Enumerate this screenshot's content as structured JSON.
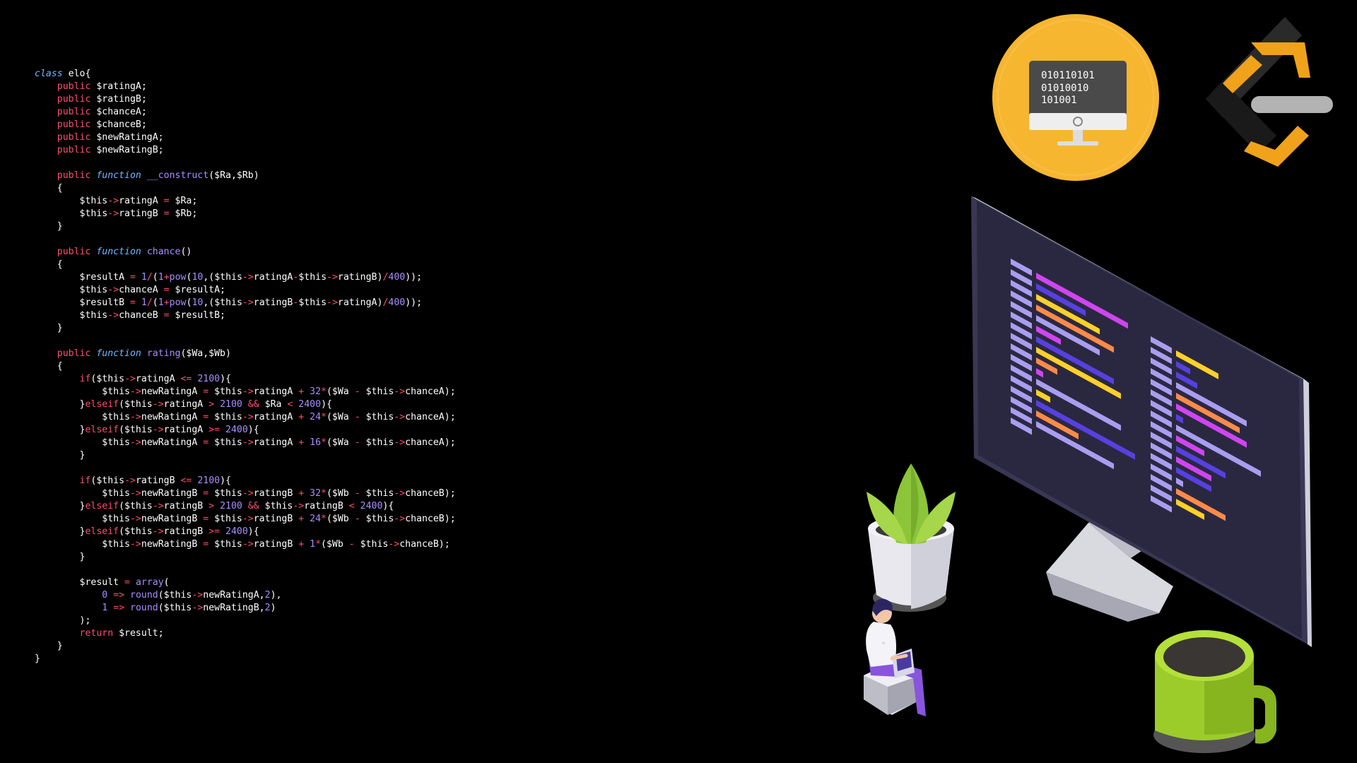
{
  "code": {
    "language": "php",
    "lines": [
      [
        [
          "cls",
          "class"
        ],
        [
          "plain",
          " elo{"
        ]
      ],
      [
        [
          "plain",
          "    "
        ],
        [
          "kw",
          "public"
        ],
        [
          "plain",
          " $ratingA;"
        ]
      ],
      [
        [
          "plain",
          "    "
        ],
        [
          "kw",
          "public"
        ],
        [
          "plain",
          " $ratingB;"
        ]
      ],
      [
        [
          "plain",
          "    "
        ],
        [
          "kw",
          "public"
        ],
        [
          "plain",
          " $chanceA;"
        ]
      ],
      [
        [
          "plain",
          "    "
        ],
        [
          "kw",
          "public"
        ],
        [
          "plain",
          " $chanceB;"
        ]
      ],
      [
        [
          "plain",
          "    "
        ],
        [
          "kw",
          "public"
        ],
        [
          "plain",
          " $newRatingA;"
        ]
      ],
      [
        [
          "plain",
          "    "
        ],
        [
          "kw",
          "public"
        ],
        [
          "plain",
          " $newRatingB;"
        ]
      ],
      [
        [
          "plain",
          ""
        ]
      ],
      [
        [
          "plain",
          "    "
        ],
        [
          "kw",
          "public"
        ],
        [
          "plain",
          " "
        ],
        [
          "fn",
          "function"
        ],
        [
          "plain",
          " "
        ],
        [
          "call",
          "__construct"
        ],
        [
          "plain",
          "($Ra,$Rb)"
        ]
      ],
      [
        [
          "plain",
          "    {"
        ]
      ],
      [
        [
          "plain",
          "        $this"
        ],
        [
          "op",
          "->"
        ],
        [
          "plain",
          "ratingA "
        ],
        [
          "op",
          "="
        ],
        [
          "plain",
          " $Ra;"
        ]
      ],
      [
        [
          "plain",
          "        $this"
        ],
        [
          "op",
          "->"
        ],
        [
          "plain",
          "ratingB "
        ],
        [
          "op",
          "="
        ],
        [
          "plain",
          " $Rb;"
        ]
      ],
      [
        [
          "plain",
          "    }"
        ]
      ],
      [
        [
          "plain",
          ""
        ]
      ],
      [
        [
          "plain",
          "    "
        ],
        [
          "kw",
          "public"
        ],
        [
          "plain",
          " "
        ],
        [
          "fn",
          "function"
        ],
        [
          "plain",
          " "
        ],
        [
          "call",
          "chance"
        ],
        [
          "plain",
          "()"
        ]
      ],
      [
        [
          "plain",
          "    {"
        ]
      ],
      [
        [
          "plain",
          "        $resultA "
        ],
        [
          "op",
          "="
        ],
        [
          "plain",
          " "
        ],
        [
          "num",
          "1"
        ],
        [
          "op",
          "/"
        ],
        [
          "plain",
          "("
        ],
        [
          "num",
          "1"
        ],
        [
          "op",
          "+"
        ],
        [
          "call",
          "pow"
        ],
        [
          "plain",
          "("
        ],
        [
          "num",
          "10"
        ],
        [
          "plain",
          ",($this"
        ],
        [
          "op",
          "->"
        ],
        [
          "plain",
          "ratingA"
        ],
        [
          "op",
          "-"
        ],
        [
          "plain",
          "$this"
        ],
        [
          "op",
          "->"
        ],
        [
          "plain",
          "ratingB)"
        ],
        [
          "op",
          "/"
        ],
        [
          "num",
          "400"
        ],
        [
          "plain",
          "));"
        ]
      ],
      [
        [
          "plain",
          "        $this"
        ],
        [
          "op",
          "->"
        ],
        [
          "plain",
          "chanceA "
        ],
        [
          "op",
          "="
        ],
        [
          "plain",
          " $resultA;"
        ]
      ],
      [
        [
          "plain",
          "        $resultB "
        ],
        [
          "op",
          "="
        ],
        [
          "plain",
          " "
        ],
        [
          "num",
          "1"
        ],
        [
          "op",
          "/"
        ],
        [
          "plain",
          "("
        ],
        [
          "num",
          "1"
        ],
        [
          "op",
          "+"
        ],
        [
          "call",
          "pow"
        ],
        [
          "plain",
          "("
        ],
        [
          "num",
          "10"
        ],
        [
          "plain",
          ",($this"
        ],
        [
          "op",
          "->"
        ],
        [
          "plain",
          "ratingB"
        ],
        [
          "op",
          "-"
        ],
        [
          "plain",
          "$this"
        ],
        [
          "op",
          "->"
        ],
        [
          "plain",
          "ratingA)"
        ],
        [
          "op",
          "/"
        ],
        [
          "num",
          "400"
        ],
        [
          "plain",
          "));"
        ]
      ],
      [
        [
          "plain",
          "        $this"
        ],
        [
          "op",
          "->"
        ],
        [
          "plain",
          "chanceB "
        ],
        [
          "op",
          "="
        ],
        [
          "plain",
          " $resultB;"
        ]
      ],
      [
        [
          "plain",
          "    }"
        ]
      ],
      [
        [
          "plain",
          ""
        ]
      ],
      [
        [
          "plain",
          "    "
        ],
        [
          "kw",
          "public"
        ],
        [
          "plain",
          " "
        ],
        [
          "fn",
          "function"
        ],
        [
          "plain",
          " "
        ],
        [
          "call",
          "rating"
        ],
        [
          "plain",
          "($Wa,$Wb)"
        ]
      ],
      [
        [
          "plain",
          "    {"
        ]
      ],
      [
        [
          "plain",
          "        "
        ],
        [
          "kw",
          "if"
        ],
        [
          "plain",
          "($this"
        ],
        [
          "op",
          "->"
        ],
        [
          "plain",
          "ratingA "
        ],
        [
          "op",
          "<="
        ],
        [
          "plain",
          " "
        ],
        [
          "num",
          "2100"
        ],
        [
          "plain",
          "){"
        ]
      ],
      [
        [
          "plain",
          "            $this"
        ],
        [
          "op",
          "->"
        ],
        [
          "plain",
          "newRatingA "
        ],
        [
          "op",
          "="
        ],
        [
          "plain",
          " $this"
        ],
        [
          "op",
          "->"
        ],
        [
          "plain",
          "ratingA "
        ],
        [
          "op",
          "+"
        ],
        [
          "plain",
          " "
        ],
        [
          "num",
          "32"
        ],
        [
          "op",
          "*"
        ],
        [
          "plain",
          "($Wa "
        ],
        [
          "op",
          "-"
        ],
        [
          "plain",
          " $this"
        ],
        [
          "op",
          "->"
        ],
        [
          "plain",
          "chanceA);"
        ]
      ],
      [
        [
          "plain",
          "        }"
        ],
        [
          "kw",
          "elseif"
        ],
        [
          "plain",
          "($this"
        ],
        [
          "op",
          "->"
        ],
        [
          "plain",
          "ratingA "
        ],
        [
          "op",
          ">"
        ],
        [
          "plain",
          " "
        ],
        [
          "num",
          "2100"
        ],
        [
          "plain",
          " "
        ],
        [
          "op",
          "&&"
        ],
        [
          "plain",
          " $Ra "
        ],
        [
          "op",
          "<"
        ],
        [
          "plain",
          " "
        ],
        [
          "num",
          "2400"
        ],
        [
          "plain",
          "){"
        ]
      ],
      [
        [
          "plain",
          "            $this"
        ],
        [
          "op",
          "->"
        ],
        [
          "plain",
          "newRatingA "
        ],
        [
          "op",
          "="
        ],
        [
          "plain",
          " $this"
        ],
        [
          "op",
          "->"
        ],
        [
          "plain",
          "ratingA "
        ],
        [
          "op",
          "+"
        ],
        [
          "plain",
          " "
        ],
        [
          "num",
          "24"
        ],
        [
          "op",
          "*"
        ],
        [
          "plain",
          "($Wa "
        ],
        [
          "op",
          "-"
        ],
        [
          "plain",
          " $this"
        ],
        [
          "op",
          "->"
        ],
        [
          "plain",
          "chanceA);"
        ]
      ],
      [
        [
          "plain",
          "        }"
        ],
        [
          "kw",
          "elseif"
        ],
        [
          "plain",
          "($this"
        ],
        [
          "op",
          "->"
        ],
        [
          "plain",
          "ratingA "
        ],
        [
          "op",
          ">="
        ],
        [
          "plain",
          " "
        ],
        [
          "num",
          "2400"
        ],
        [
          "plain",
          "){"
        ]
      ],
      [
        [
          "plain",
          "            $this"
        ],
        [
          "op",
          "->"
        ],
        [
          "plain",
          "newRatingA "
        ],
        [
          "op",
          "="
        ],
        [
          "plain",
          " $this"
        ],
        [
          "op",
          "->"
        ],
        [
          "plain",
          "ratingA "
        ],
        [
          "op",
          "+"
        ],
        [
          "plain",
          " "
        ],
        [
          "num",
          "16"
        ],
        [
          "op",
          "*"
        ],
        [
          "plain",
          "($Wa "
        ],
        [
          "op",
          "-"
        ],
        [
          "plain",
          " $this"
        ],
        [
          "op",
          "->"
        ],
        [
          "plain",
          "chanceA);"
        ]
      ],
      [
        [
          "plain",
          "        }"
        ]
      ],
      [
        [
          "plain",
          ""
        ]
      ],
      [
        [
          "plain",
          "        "
        ],
        [
          "kw",
          "if"
        ],
        [
          "plain",
          "($this"
        ],
        [
          "op",
          "->"
        ],
        [
          "plain",
          "ratingB "
        ],
        [
          "op",
          "<="
        ],
        [
          "plain",
          " "
        ],
        [
          "num",
          "2100"
        ],
        [
          "plain",
          "){"
        ]
      ],
      [
        [
          "plain",
          "            $this"
        ],
        [
          "op",
          "->"
        ],
        [
          "plain",
          "newRatingB "
        ],
        [
          "op",
          "="
        ],
        [
          "plain",
          " $this"
        ],
        [
          "op",
          "->"
        ],
        [
          "plain",
          "ratingB "
        ],
        [
          "op",
          "+"
        ],
        [
          "plain",
          " "
        ],
        [
          "num",
          "32"
        ],
        [
          "op",
          "*"
        ],
        [
          "plain",
          "($Wb "
        ],
        [
          "op",
          "-"
        ],
        [
          "plain",
          " $this"
        ],
        [
          "op",
          "->"
        ],
        [
          "plain",
          "chanceB);"
        ]
      ],
      [
        [
          "plain",
          "        }"
        ],
        [
          "kw",
          "elseif"
        ],
        [
          "plain",
          "($this"
        ],
        [
          "op",
          "->"
        ],
        [
          "plain",
          "ratingB "
        ],
        [
          "op",
          ">"
        ],
        [
          "plain",
          " "
        ],
        [
          "num",
          "2100"
        ],
        [
          "plain",
          " "
        ],
        [
          "op",
          "&&"
        ],
        [
          "plain",
          " $this"
        ],
        [
          "op",
          "->"
        ],
        [
          "plain",
          "ratingB "
        ],
        [
          "op",
          "<"
        ],
        [
          "plain",
          " "
        ],
        [
          "num",
          "2400"
        ],
        [
          "plain",
          "){"
        ]
      ],
      [
        [
          "plain",
          "            $this"
        ],
        [
          "op",
          "->"
        ],
        [
          "plain",
          "newRatingB "
        ],
        [
          "op",
          "="
        ],
        [
          "plain",
          " $this"
        ],
        [
          "op",
          "->"
        ],
        [
          "plain",
          "ratingB "
        ],
        [
          "op",
          "+"
        ],
        [
          "plain",
          " "
        ],
        [
          "num",
          "24"
        ],
        [
          "op",
          "*"
        ],
        [
          "plain",
          "($Wb "
        ],
        [
          "op",
          "-"
        ],
        [
          "plain",
          " $this"
        ],
        [
          "op",
          "->"
        ],
        [
          "plain",
          "chanceB);"
        ]
      ],
      [
        [
          "plain",
          "        }"
        ],
        [
          "kw",
          "elseif"
        ],
        [
          "plain",
          "($this"
        ],
        [
          "op",
          "->"
        ],
        [
          "plain",
          "ratingB "
        ],
        [
          "op",
          ">="
        ],
        [
          "plain",
          " "
        ],
        [
          "num",
          "2400"
        ],
        [
          "plain",
          "){"
        ]
      ],
      [
        [
          "plain",
          "            $this"
        ],
        [
          "op",
          "->"
        ],
        [
          "plain",
          "newRatingB "
        ],
        [
          "op",
          "="
        ],
        [
          "plain",
          " $this"
        ],
        [
          "op",
          "->"
        ],
        [
          "plain",
          "ratingB "
        ],
        [
          "op",
          "+"
        ],
        [
          "plain",
          " "
        ],
        [
          "num",
          "1"
        ],
        [
          "op",
          "*"
        ],
        [
          "plain",
          "($Wb "
        ],
        [
          "op",
          "-"
        ],
        [
          "plain",
          " $this"
        ],
        [
          "op",
          "->"
        ],
        [
          "plain",
          "chanceB);"
        ]
      ],
      [
        [
          "plain",
          "        }"
        ]
      ],
      [
        [
          "plain",
          ""
        ]
      ],
      [
        [
          "plain",
          "        $result "
        ],
        [
          "op",
          "="
        ],
        [
          "plain",
          " "
        ],
        [
          "call",
          "array"
        ],
        [
          "plain",
          "("
        ]
      ],
      [
        [
          "plain",
          "            "
        ],
        [
          "num",
          "0"
        ],
        [
          "plain",
          " "
        ],
        [
          "op",
          "=>"
        ],
        [
          "plain",
          " "
        ],
        [
          "call",
          "round"
        ],
        [
          "plain",
          "($this"
        ],
        [
          "op",
          "->"
        ],
        [
          "plain",
          "newRatingA,"
        ],
        [
          "num",
          "2"
        ],
        [
          "plain",
          "),"
        ]
      ],
      [
        [
          "plain",
          "            "
        ],
        [
          "num",
          "1"
        ],
        [
          "plain",
          " "
        ],
        [
          "op",
          "=>"
        ],
        [
          "plain",
          " "
        ],
        [
          "call",
          "round"
        ],
        [
          "plain",
          "($this"
        ],
        [
          "op",
          "->"
        ],
        [
          "plain",
          "newRatingB,"
        ],
        [
          "num",
          "2"
        ],
        [
          "plain",
          ")"
        ]
      ],
      [
        [
          "plain",
          "        );"
        ]
      ],
      [
        [
          "plain",
          "        "
        ],
        [
          "kw",
          "return"
        ],
        [
          "plain",
          " $result;"
        ]
      ],
      [
        [
          "plain",
          "    }"
        ]
      ],
      [
        [
          "plain",
          "}"
        ]
      ]
    ]
  },
  "badge": {
    "icon": "binary-monitor-icon",
    "lines": [
      "010110101",
      "01010010",
      "101001"
    ],
    "color": "#f7b630"
  },
  "logo": {
    "icon": "leetcode-logo-icon",
    "colors": {
      "dark": "#2a2a2a",
      "orange": "#f0a21a",
      "gray": "#b3b3b3"
    }
  },
  "illustration": {
    "monitor": "monitor-icon",
    "plant": "potted-plant-icon",
    "person": "person-with-laptop-icon",
    "mug": "coffee-mug-icon",
    "colors": {
      "screen": "#2a2840",
      "bezel": "#1f1d33",
      "purple": "#a99df0",
      "magenta": "#cf45f0",
      "blue": "#5740e0",
      "orange": "#ff8a4a",
      "yellow": "#ffd02a",
      "mug": "#9ccc2a",
      "leaf": "#8cc43a"
    }
  }
}
